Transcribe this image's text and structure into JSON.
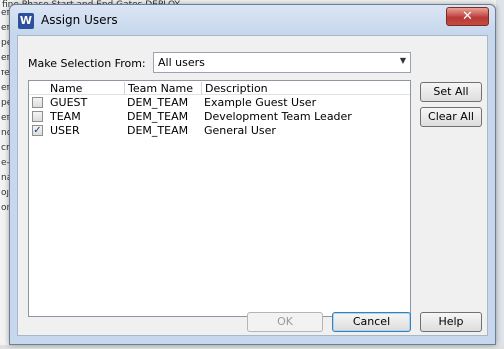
{
  "background": {
    "top_text": "fine Phase Start and End Gates DEPLOY",
    "left_fragments": [
      "ef",
      "ef",
      "pe",
      "ef",
      "fe",
      "ef",
      "pe",
      "ef",
      "nd",
      "ch",
      "e-V",
      "na",
      "oj",
      "or"
    ]
  },
  "dialog": {
    "title": "Assign Users",
    "app_icon_letter": "W",
    "close_glyph": "✕",
    "selection_label": "Make Selection From:",
    "selection_value": "All users",
    "dropdown_arrow": "▼",
    "columns": {
      "name": "Name",
      "team": "Team Name",
      "description": "Description"
    },
    "users": [
      {
        "checked": false,
        "check_mark": "",
        "name": "GUEST",
        "team": "DEM_TEAM",
        "description": "Example Guest User"
      },
      {
        "checked": false,
        "check_mark": "",
        "name": "TEAM",
        "team": "DEM_TEAM",
        "description": "Development Team Leader"
      },
      {
        "checked": true,
        "check_mark": "✓",
        "name": "USER",
        "team": "DEM_TEAM",
        "description": "General User"
      }
    ],
    "buttons": {
      "set_all": "Set All",
      "clear_all": "Clear All",
      "ok": "OK",
      "cancel": "Cancel",
      "help": "Help"
    }
  }
}
